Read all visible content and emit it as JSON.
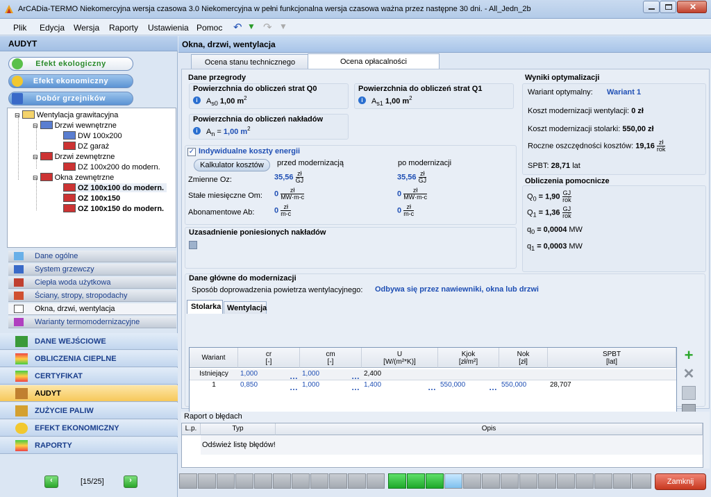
{
  "window": {
    "title": "ArCADia-TERMO Niekomercyjna wersja czasowa 3.0 Niekomercyjna w pełni funkcjonalna wersja czasowa ważna przez następne 30 dni. - All_Jedn_2b"
  },
  "menu": [
    "Plik",
    "Edycja",
    "Wersja",
    "Raporty",
    "Ustawienia",
    "Pomoc"
  ],
  "sidebar": {
    "header": "AUDYT",
    "pills": [
      "Efekt ekologiczny",
      "Efekt ekonomiczny",
      "Dobór grzejników"
    ],
    "tree": [
      "Wentylacja grawitacyjna",
      "Drzwi wewnętrzne",
      "DW 100x200",
      "DZ garaż",
      "Drzwi zewnętrzne",
      "DZ 100x200 do modern.",
      "Okna zewnętrzne",
      "OZ 100x100 do modern.",
      "OZ 100x150",
      "OZ 100x150 do modern."
    ],
    "nav": [
      "Dane ogólne",
      "System grzewczy",
      "Ciepła woda użytkowa",
      "Ściany, stropy, stropodachy",
      "Okna, drzwi, wentylacja",
      "Warianty termomodernizacyjne"
    ],
    "big": [
      "DANE WEJŚCIOWE",
      "OBLICZENIA CIEPLNE",
      "CERTYFIKAT",
      "AUDYT",
      "ZUŻYCIE PALIW",
      "EFEKT EKONOMICZNY",
      "RAPORTY"
    ],
    "pager": "[15/25]"
  },
  "main": {
    "title": "Okna, drzwi, wentylacja",
    "tabs": [
      "Ocena stanu technicznego",
      "Ocena opłacalności"
    ],
    "dane_przegrody": {
      "title": "Dane przegrody",
      "q0_title": "Powierzchnia do obliczeń strat Q0",
      "q0_sym": "A",
      "q0_sub": "s0",
      "q0_val": "1,00 m",
      "q0_exp": "2",
      "q1_title": "Powierzchnia do obliczeń strat Q1",
      "q1_sym": "A",
      "q1_sub": "s1",
      "q1_val": "1,00 m",
      "q1_exp": "2",
      "n_title": "Powierzchnia do obliczeń nakładów",
      "n_sym": "A",
      "n_sub": "n",
      "n_eq": "=",
      "n_val": "1,00 m",
      "n_exp": "2"
    },
    "koszty": {
      "checkbox": "Indywidualne koszty energii",
      "calc_button": "Kalkulator kosztów",
      "col_before": "przed modernizacją",
      "col_after": "po modernizacji",
      "rows": [
        {
          "label": "Zmienne Oz:",
          "before": "35,56",
          "after": "35,56",
          "num": "zł",
          "den": "GJ"
        },
        {
          "label": "Stałe miesięczne Om:",
          "before": "0",
          "after": "0",
          "num": "zł",
          "den": "MW·m-c"
        },
        {
          "label": "Abonamentowe Ab:",
          "before": "0",
          "after": "0",
          "num": "zł",
          "den": "m-c"
        }
      ]
    },
    "uzasadnienie": "Uzasadnienie poniesionych nakładów",
    "wyniki": {
      "title": "Wyniki optymalizacji",
      "wariant_label": "Wariant optymalny:",
      "wariant_val": "Wariant 1",
      "koszt_went_label": "Koszt modernizacji wentylacji:",
      "koszt_went_val": "0 zł",
      "koszt_stol_label": "Koszt modernizacji stolarki:",
      "koszt_stol_val": "550,00 zł",
      "oszcz_label": "Roczne oszczędności kosztów:",
      "oszcz_val": "19,16",
      "oszcz_num": "zł",
      "oszcz_den": "rok",
      "spbt_label": "SPBT:",
      "spbt_val": "28,71",
      "spbt_unit": "lat"
    },
    "pomocnicze": {
      "title": "Obliczenia pomocnicze",
      "rows": [
        {
          "sym": "Q",
          "sub": "0",
          "val": "= 1,90",
          "num": "GJ",
          "den": "rok"
        },
        {
          "sym": "Q",
          "sub": "1",
          "val": "= 1,36",
          "num": "GJ",
          "den": "rok"
        },
        {
          "sym": "q",
          "sub": "0",
          "val": "= 0,0004",
          "unit": "MW"
        },
        {
          "sym": "q",
          "sub": "1",
          "val": "= 0,0003",
          "unit": "MW"
        }
      ]
    },
    "dane_glowne": {
      "title": "Dane główne do modernizacji",
      "sposob_label": "Sposób doprowadzenia powietrza wentylacyjnego:",
      "sposob_val": "Odbywa się przez nawiewniki, okna lub drzwi",
      "subtabs": [
        "Stolarka",
        "Wentylacja"
      ],
      "columns": [
        [
          "Wariant",
          ""
        ],
        [
          "cr",
          "[-]"
        ],
        [
          "cm",
          "[-]"
        ],
        [
          "U",
          "[W/(m²*K)]"
        ],
        [
          "Kjok",
          "[zł/m²]"
        ],
        [
          "Nok",
          "[zł]"
        ],
        [
          "SPBT",
          "[lat]"
        ]
      ],
      "rows": [
        [
          "Istniejący",
          "1,000",
          "1,000",
          "2,400",
          "",
          "",
          ""
        ],
        [
          "1",
          "0,850",
          "1,000",
          "1,400",
          "550,000",
          "550,000",
          "28,707"
        ]
      ]
    },
    "report": {
      "title": "Raport o błędach",
      "cols": [
        "L.p.",
        "Typ",
        "Opis"
      ],
      "message": "Odśwież listę błędów!"
    },
    "close_button": "Zamknij"
  }
}
